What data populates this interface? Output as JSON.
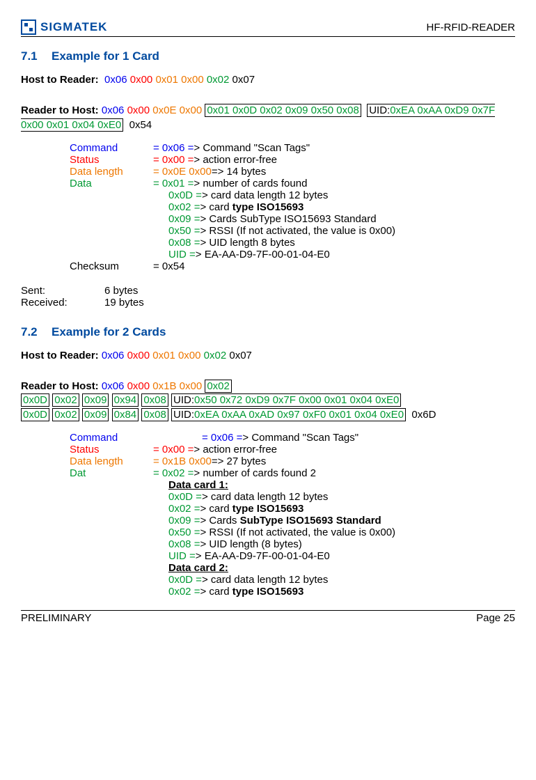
{
  "header": {
    "logo_text": "SIGMATEK",
    "doc_id": "HF-RFID-READER"
  },
  "s71": {
    "num": "7.1",
    "title": "Example for 1 Card",
    "h2r_label": "Host to Reader:",
    "h2r": {
      "b1": "0x06",
      "b2": "0x00",
      "b3": "0x01",
      "b4": "0x00",
      "b5": "0x02",
      "b6": "0x07"
    },
    "r2h_label": "Reader to Host:",
    "r2h": {
      "p1": "0x06",
      "p2": "0x00",
      "p3": "0x0E",
      "p4": "0x00",
      "box": "0x01 0x0D 0x02 0x09 0x50 0x08",
      "uid_lbl": "UID:",
      "uid": "0xEA 0xAA 0xD9 0x7F 0x00 0x01 0x04 0xE0",
      "chk": "0x54"
    },
    "cmd": {
      "l1a": "Command",
      "l1b": "= 0x06 =",
      "l1c": "> Command \"Scan Tags\"",
      "l2a": "Status",
      "l2b": "= 0x00 =",
      "l2c": "> action error-free",
      "l3a": "Data length",
      "l3b": "=    0x0E 0x00",
      "l3c": "=> 14 bytes",
      "l4a": "Data",
      "l4b": "= 0x01 =",
      "l4c": "> number of cards found",
      "s1": "0x0D =",
      "s1c": "> card data length 12 bytes",
      "s2": "0x02 =",
      "s2c_a": "> card ",
      "s2c_b": "type ISO15693",
      "s3": "0x09 =",
      "s3c": "> Cards SubType ISO15693 Standard",
      "s4": "0x50 =",
      "s4c": "> RSSI (If not activated, the value is 0x00)",
      "s5": "0x08 =",
      "s5c": "> UID length 8 bytes",
      "s6": "UID  =",
      "s6c": ">  EA-AA-D9-7F-00-01-04-E0",
      "l5a": "Checksum",
      "l5b": "= 0x54"
    },
    "sent_lbl": "Sent:",
    "sent_val": "6 bytes",
    "recv_lbl": "Received:",
    "recv_val": "19 bytes"
  },
  "s72": {
    "num": "7.2",
    "title": "Example for 2 Cards",
    "h2r_label": "Host to Reader:",
    "h2r": {
      "b1": "0x06",
      "b2": "0x00",
      "b3": "0x01",
      "b4": "0x00",
      "b5": "0x02",
      "b6": "0x07"
    },
    "r2h_label": "Reader to Host:",
    "r2h": {
      "p1": "0x06",
      "p2": "0x00",
      "p3": "0x1B",
      "p4": "0x00",
      "p5": "0x02",
      "row1_boxes": [
        "0x0D",
        "0x02",
        "0x09",
        "0x94",
        "0x08"
      ],
      "row1_uid_lbl": "UID:",
      "row1_uid": "0x50  0x72 0xD9 0x7F  0x00 0x01 0x04 0xE0",
      "row2_boxes": [
        "0x0D",
        "0x02",
        "0x09",
        "0x84",
        "0x08"
      ],
      "row2_uid_lbl": "UID:",
      "row2_uid": "0xEA 0xAA 0xAD 0x97 0xF0 0x01 0x04 0xE0",
      "chk": "0x6D"
    },
    "cmd": {
      "l1a": "Command",
      "l1b": "= 0x06 =",
      "l1c": "> Command \"Scan Tags\"",
      "l2a": "Status",
      "l2b": "= 0x00 =",
      "l2c": "> action error-free",
      "l3a": "Data length",
      "l3b": "=   0x1B 0x00",
      "l3c": "=> 27 bytes",
      "l4a": "Dat",
      "l4b": "= 0x02 =",
      "l4c": "> number of cards found 2",
      "h1": "Data card 1:",
      "s1": "0x0D =",
      "s1c": "> card data length 12 bytes",
      "s2": "0x02 =",
      "s2c_a": "> card ",
      "s2c_b": "type ISO15693",
      "s3": "0x09 =",
      "s3c_a": "> Cards ",
      "s3c_b": "SubType ISO15693 Standard",
      "s4": "0x50 =",
      "s4c": "> RSSI (If not activated, the value is 0x00)",
      "s5": "0x08 =",
      "s5c": "> UID length (8 bytes)",
      "s6": "UID  =",
      "s6c": ">  EA-AA-D9-7F-00-01-04-E0",
      "h2": "Data card 2:",
      "t1": "0x0D =",
      "t1c": "> card data length 12 bytes",
      "t2": "0x02 =",
      "t2c_a": "> card ",
      "t2c_b": "type ISO15693"
    }
  },
  "footer": {
    "left": "PRELIMINARY",
    "right": "Page 25"
  }
}
